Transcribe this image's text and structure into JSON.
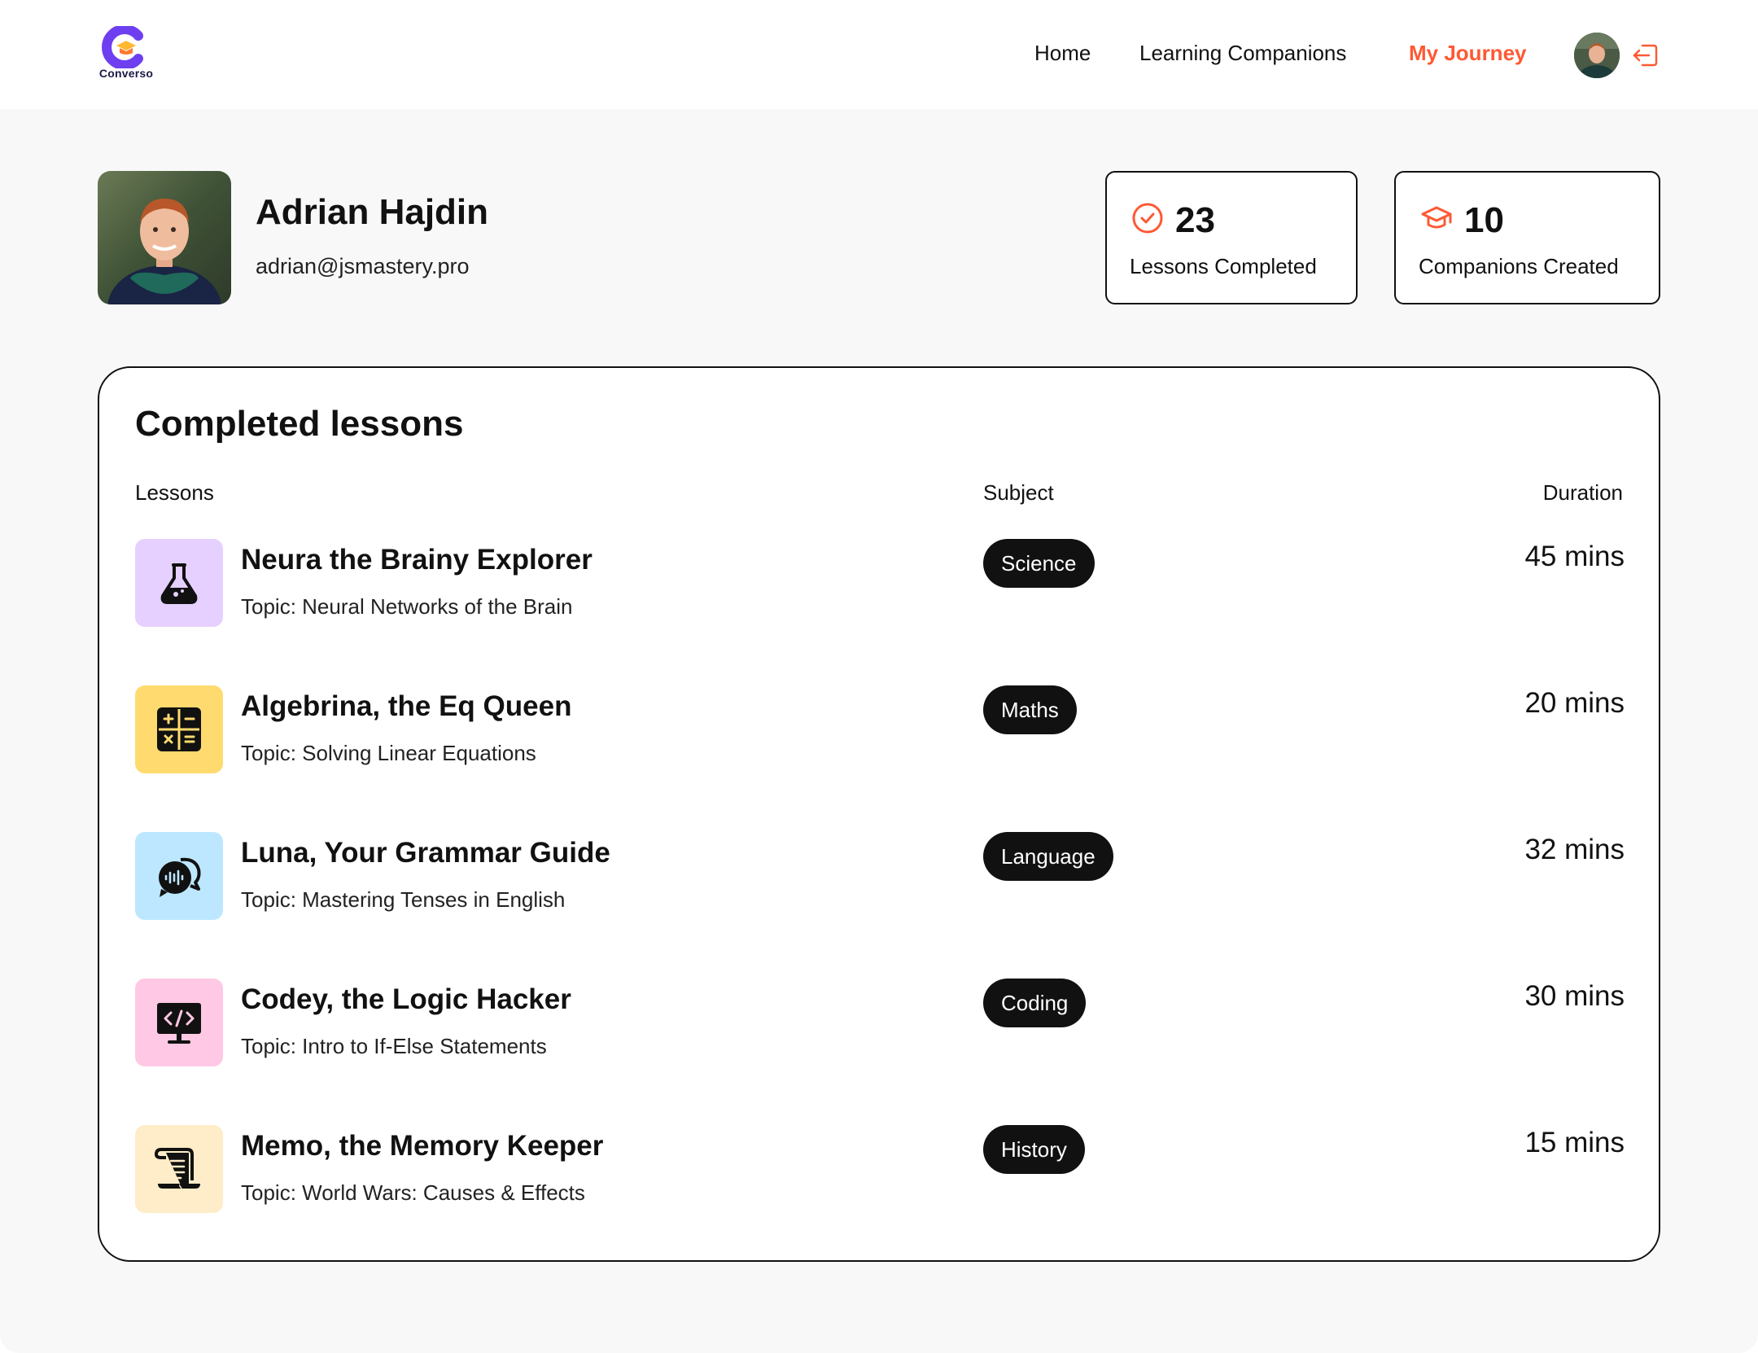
{
  "app": {
    "logo_text": "Converso"
  },
  "nav": {
    "links": [
      {
        "label": "Home",
        "active": false
      },
      {
        "label": "Learning Companions",
        "active": false
      },
      {
        "label": "My Journey",
        "active": true
      }
    ],
    "accent_color": "#fe5933"
  },
  "profile": {
    "name": "Adrian Hajdin",
    "email": "adrian@jsmastery.pro"
  },
  "stats": [
    {
      "icon": "check-circle-icon",
      "value": "23",
      "label": "Lessons Completed"
    },
    {
      "icon": "graduation-cap-icon",
      "value": "10",
      "label": "Companions Created"
    }
  ],
  "lessons_panel": {
    "title": "Completed lessons",
    "columns": {
      "lessons": "Lessons",
      "subject": "Subject",
      "duration": "Duration"
    },
    "rows": [
      {
        "name": "Neura the Brainy Explorer",
        "topic": "Topic: Neural Networks of the Brain",
        "subject": "Science",
        "duration": "45 mins",
        "icon": "flask-icon",
        "icon_bg": "#e5d0ff"
      },
      {
        "name": "Algebrina, the Eq Queen",
        "topic": "Topic: Solving Linear Equations",
        "subject": "Maths",
        "duration": "20 mins",
        "icon": "calculator-icon",
        "icon_bg": "#ffda6e"
      },
      {
        "name": "Luna, Your Grammar Guide",
        "topic": "Topic: Mastering Tenses in English",
        "subject": "Language",
        "duration": "32 mins",
        "icon": "chat-bubbles-icon",
        "icon_bg": "#bde7ff"
      },
      {
        "name": "Codey, the Logic Hacker",
        "topic": "Topic: Intro to If-Else Statements",
        "subject": "Coding",
        "duration": "30 mins",
        "icon": "code-monitor-icon",
        "icon_bg": "#ffc8e4"
      },
      {
        "name": "Memo, the Memory Keeper",
        "topic": "Topic: World Wars: Causes & Effects",
        "subject": "History",
        "duration": "15 mins",
        "icon": "scroll-icon",
        "icon_bg": "#ffecc8"
      }
    ]
  }
}
